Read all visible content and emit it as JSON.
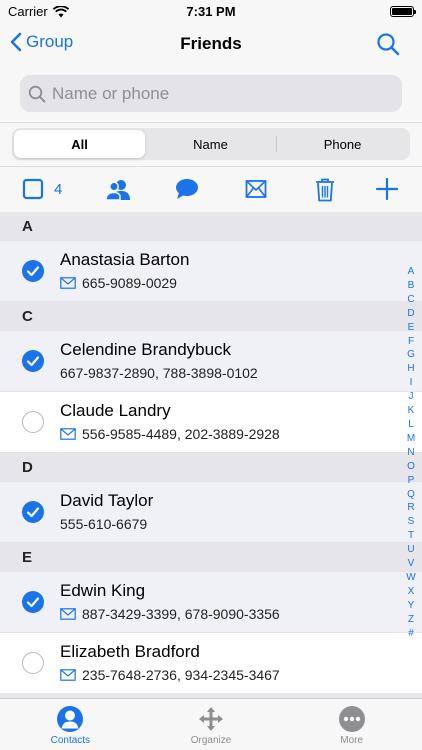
{
  "status": {
    "carrier": "Carrier",
    "time": "7:31 PM"
  },
  "nav": {
    "back_label": "Group",
    "title": "Friends"
  },
  "search": {
    "placeholder": "Name or phone"
  },
  "segments": [
    "All",
    "Name",
    "Phone"
  ],
  "toolbar": {
    "selected_count": "4"
  },
  "sections": [
    {
      "letter": "A",
      "contacts": [
        {
          "name": "Anastasia Barton",
          "phones": "665-9089-0029",
          "mail_icon": true,
          "selected": true
        }
      ]
    },
    {
      "letter": "C",
      "contacts": [
        {
          "name": "Celendine Brandybuck",
          "phones": "667-9837-2890, 788-3898-0102",
          "mail_icon": false,
          "selected": true
        },
        {
          "name": "Claude Landry",
          "phones": "556-9585-4489, 202-3889-2928",
          "mail_icon": true,
          "selected": false
        }
      ]
    },
    {
      "letter": "D",
      "contacts": [
        {
          "name": "David Taylor",
          "phones": "555-610-6679",
          "mail_icon": false,
          "selected": true
        }
      ]
    },
    {
      "letter": "E",
      "contacts": [
        {
          "name": "Edwin King",
          "phones": "887-3429-3399, 678-9090-3356",
          "mail_icon": true,
          "selected": true
        },
        {
          "name": "Elizabeth Bradford",
          "phones": "235-7648-2736, 934-2345-3467",
          "mail_icon": true,
          "selected": false
        }
      ]
    }
  ],
  "index_letters": [
    "A",
    "B",
    "C",
    "D",
    "E",
    "F",
    "G",
    "H",
    "I",
    "J",
    "K",
    "L",
    "M",
    "N",
    "O",
    "P",
    "Q",
    "R",
    "S",
    "T",
    "U",
    "V",
    "W",
    "X",
    "Y",
    "Z",
    "#"
  ],
  "tabs": [
    {
      "label": "Contacts",
      "icon": "person-circle-icon",
      "active": true
    },
    {
      "label": "Organize",
      "icon": "move-arrows-icon",
      "active": false
    },
    {
      "label": "More",
      "icon": "more-dots-icon",
      "active": false
    }
  ],
  "colors": {
    "accent": "#1a73e8",
    "section_bg": "#e5e5ea",
    "selected_row_bg": "#f0f0f7"
  }
}
